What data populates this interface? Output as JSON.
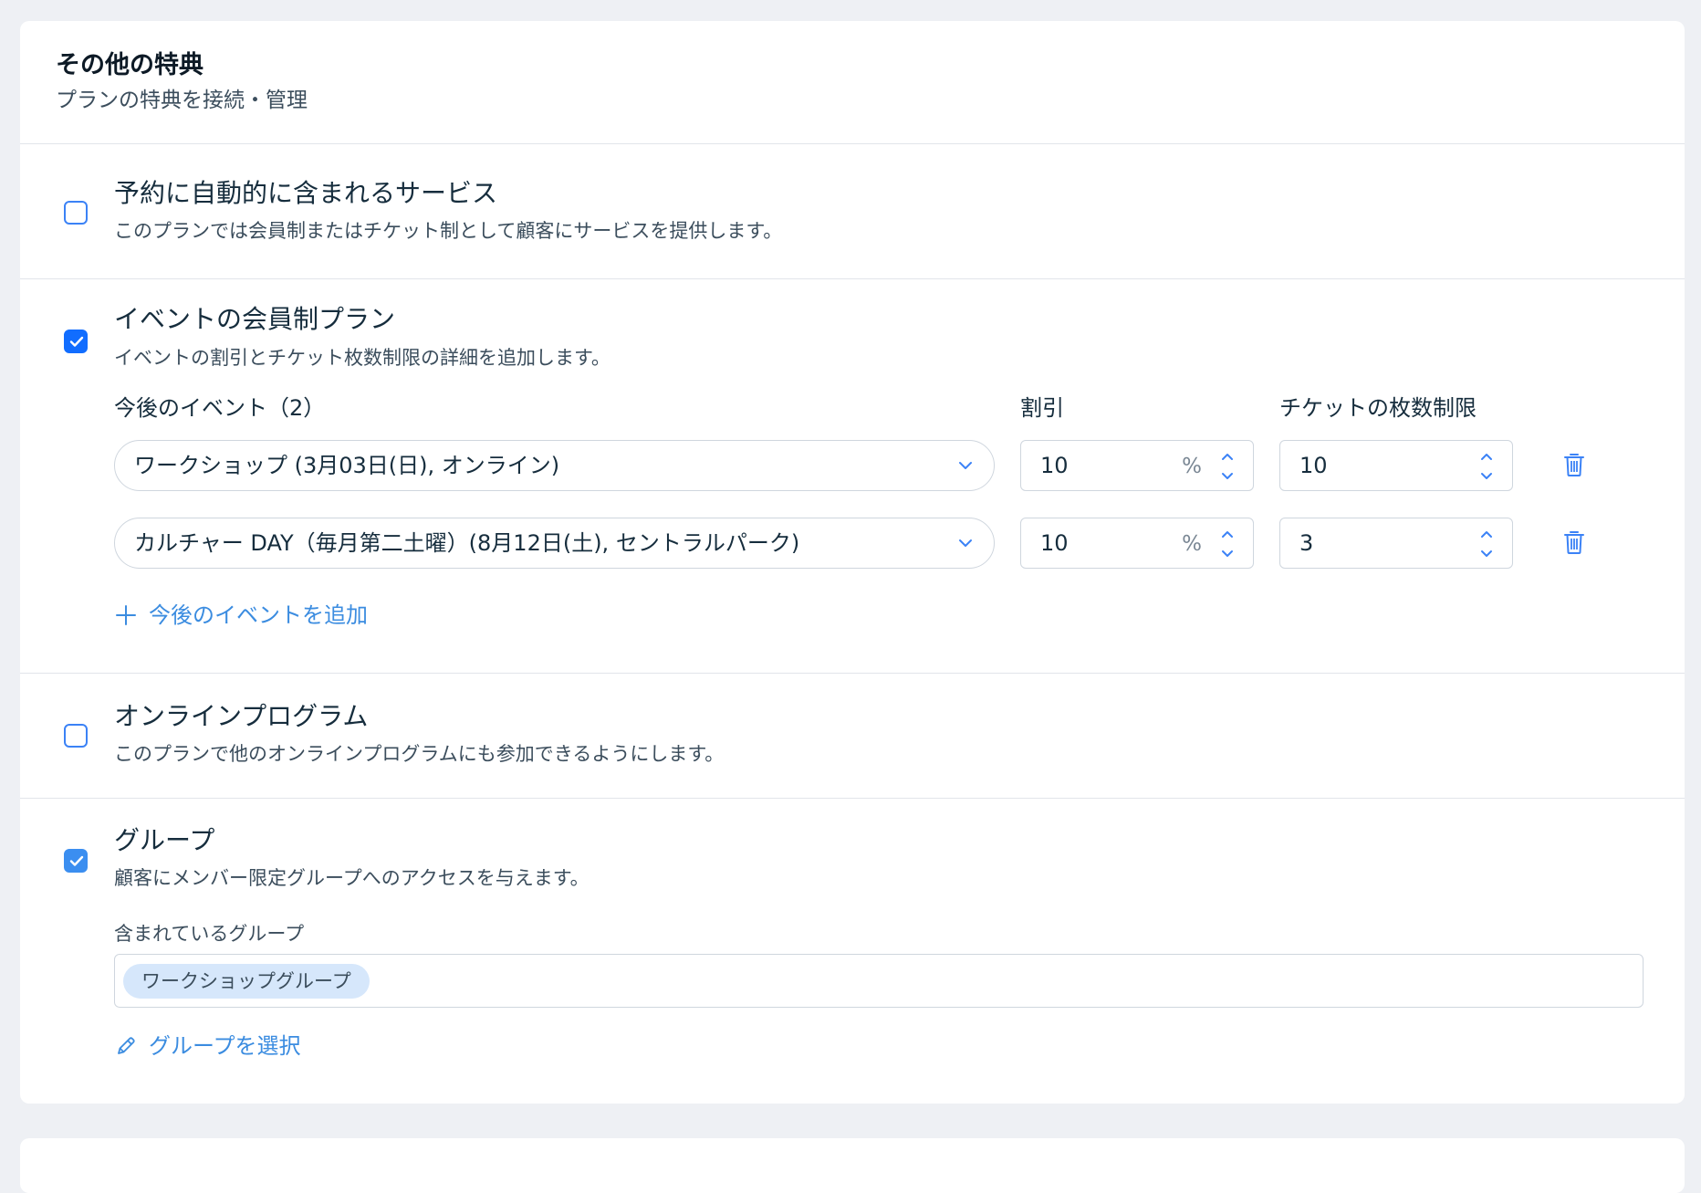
{
  "header": {
    "title": "その他の特典",
    "subtitle": "プランの特典を接続・管理"
  },
  "sections": {
    "bookings": {
      "title": "予約に自動的に含まれるサービス",
      "description": "このプランでは会員制またはチケット制として顧客にサービスを提供します。",
      "checked": false
    },
    "events": {
      "title": "イベントの会員制プラン",
      "description": "イベントの割引とチケット枚数制限の詳細を追加します。",
      "checked": true,
      "col_event": "今後のイベント（2）",
      "col_discount": "割引",
      "col_limit": "チケットの枚数制限",
      "rows": [
        {
          "event": "ワークショップ (3月03日(日), オンライン)",
          "discount": "10",
          "unit": "%",
          "limit": "10"
        },
        {
          "event": "カルチャー DAY（毎月第二土曜）(8月12日(土), セントラルパーク)",
          "discount": "10",
          "unit": "%",
          "limit": "3"
        }
      ],
      "add_label": "今後のイベントを追加"
    },
    "online": {
      "title": "オンラインプログラム",
      "description": "このプランで他のオンラインプログラムにも参加できるようにします。",
      "checked": false
    },
    "groups": {
      "title": "グループ",
      "description": "顧客にメンバー限定グループへのアクセスを与えます。",
      "checked": true,
      "included_label": "含まれているグループ",
      "tags": [
        "ワークショップグループ"
      ],
      "select_label": "グループを選択"
    }
  },
  "colors": {
    "accent": "#116dff",
    "link": "#3b8ce0",
    "tag_bg": "#d6e7fb"
  }
}
